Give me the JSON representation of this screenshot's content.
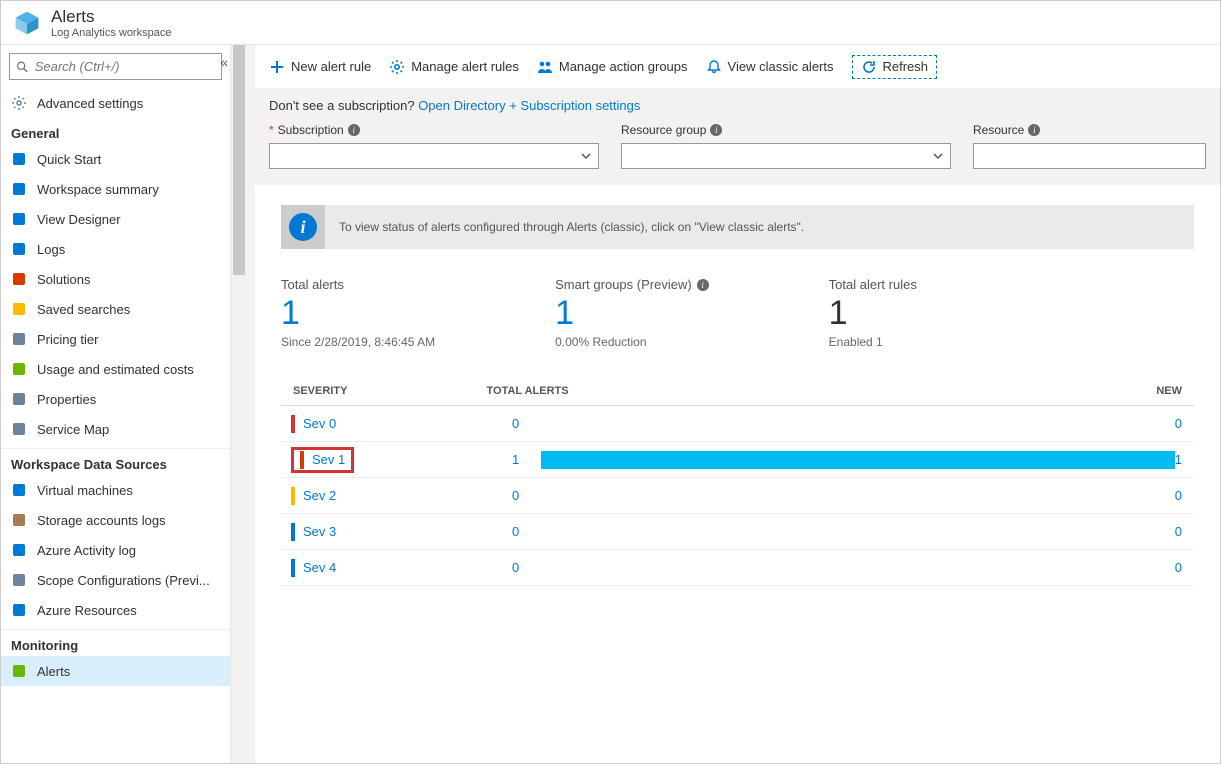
{
  "header": {
    "title": "Alerts",
    "subtitle": "Log Analytics workspace"
  },
  "search": {
    "placeholder": "Search (Ctrl+/)"
  },
  "sidebar": {
    "advanced": "Advanced settings",
    "sections": [
      {
        "title": "General",
        "items": [
          {
            "label": "Quick Start",
            "icon": "cloud",
            "color": "#0078d4"
          },
          {
            "label": "Workspace summary",
            "icon": "grid",
            "color": "#0078d4"
          },
          {
            "label": "View Designer",
            "icon": "layout",
            "color": "#0078d4"
          },
          {
            "label": "Logs",
            "icon": "logs",
            "color": "#0078d4"
          },
          {
            "label": "Solutions",
            "icon": "squares",
            "color": "#d83b01"
          },
          {
            "label": "Saved searches",
            "icon": "star",
            "color": "#ffb900"
          },
          {
            "label": "Pricing tier",
            "icon": "bars",
            "color": "#6b849c"
          },
          {
            "label": "Usage and estimated costs",
            "icon": "circle",
            "color": "#6bb700"
          },
          {
            "label": "Properties",
            "icon": "bars",
            "color": "#6b849c"
          },
          {
            "label": "Service Map",
            "icon": "map",
            "color": "#6b849c"
          }
        ]
      },
      {
        "title": "Workspace Data Sources",
        "items": [
          {
            "label": "Virtual machines",
            "icon": "vm",
            "color": "#0078d4"
          },
          {
            "label": "Storage accounts logs",
            "icon": "storage",
            "color": "#a67c52"
          },
          {
            "label": "Azure Activity log",
            "icon": "activity",
            "color": "#0078d4"
          },
          {
            "label": "Scope Configurations (Previ...",
            "icon": "scope",
            "color": "#6b849c"
          },
          {
            "label": "Azure Resources",
            "icon": "cube",
            "color": "#0078d4"
          }
        ]
      },
      {
        "title": "Monitoring",
        "items": [
          {
            "label": "Alerts",
            "icon": "alert",
            "color": "#6bb700",
            "active": true
          }
        ]
      }
    ]
  },
  "toolbar": {
    "new_rule": "New alert rule",
    "manage_rules": "Manage alert rules",
    "manage_groups": "Manage action groups",
    "view_classic": "View classic alerts",
    "refresh": "Refresh"
  },
  "filter": {
    "msg_prefix": "Don't see a subscription? ",
    "link": "Open Directory + Subscription settings",
    "subscription": "Subscription",
    "resource_group": "Resource group",
    "resource": "Resource"
  },
  "banner": "To view status of alerts configured through Alerts (classic), click on \"View classic alerts\".",
  "stats": {
    "total_label": "Total alerts",
    "total_value": "1",
    "total_sub": "Since 2/28/2019, 8:46:45 AM",
    "smart_label": "Smart groups (Preview)",
    "smart_value": "1",
    "smart_sub": "0.00% Reduction",
    "rules_label": "Total alert rules",
    "rules_value": "1",
    "rules_sub": "Enabled 1"
  },
  "table": {
    "h_severity": "SEVERITY",
    "h_total": "TOTAL ALERTS",
    "h_new": "NEW",
    "rows": [
      {
        "sev": "Sev 0",
        "color": "#d13438",
        "total": "0",
        "new": "0",
        "fill": false,
        "highlight": false
      },
      {
        "sev": "Sev 1",
        "color": "#d83b01",
        "total": "1",
        "new": "1",
        "fill": true,
        "highlight": true
      },
      {
        "sev": "Sev 2",
        "color": "#ffb900",
        "total": "0",
        "new": "0",
        "fill": false,
        "highlight": false
      },
      {
        "sev": "Sev 3",
        "color": "#0078d4",
        "total": "0",
        "new": "0",
        "fill": false,
        "highlight": false
      },
      {
        "sev": "Sev 4",
        "color": "#0078d4",
        "total": "0",
        "new": "0",
        "fill": false,
        "highlight": false
      }
    ]
  }
}
